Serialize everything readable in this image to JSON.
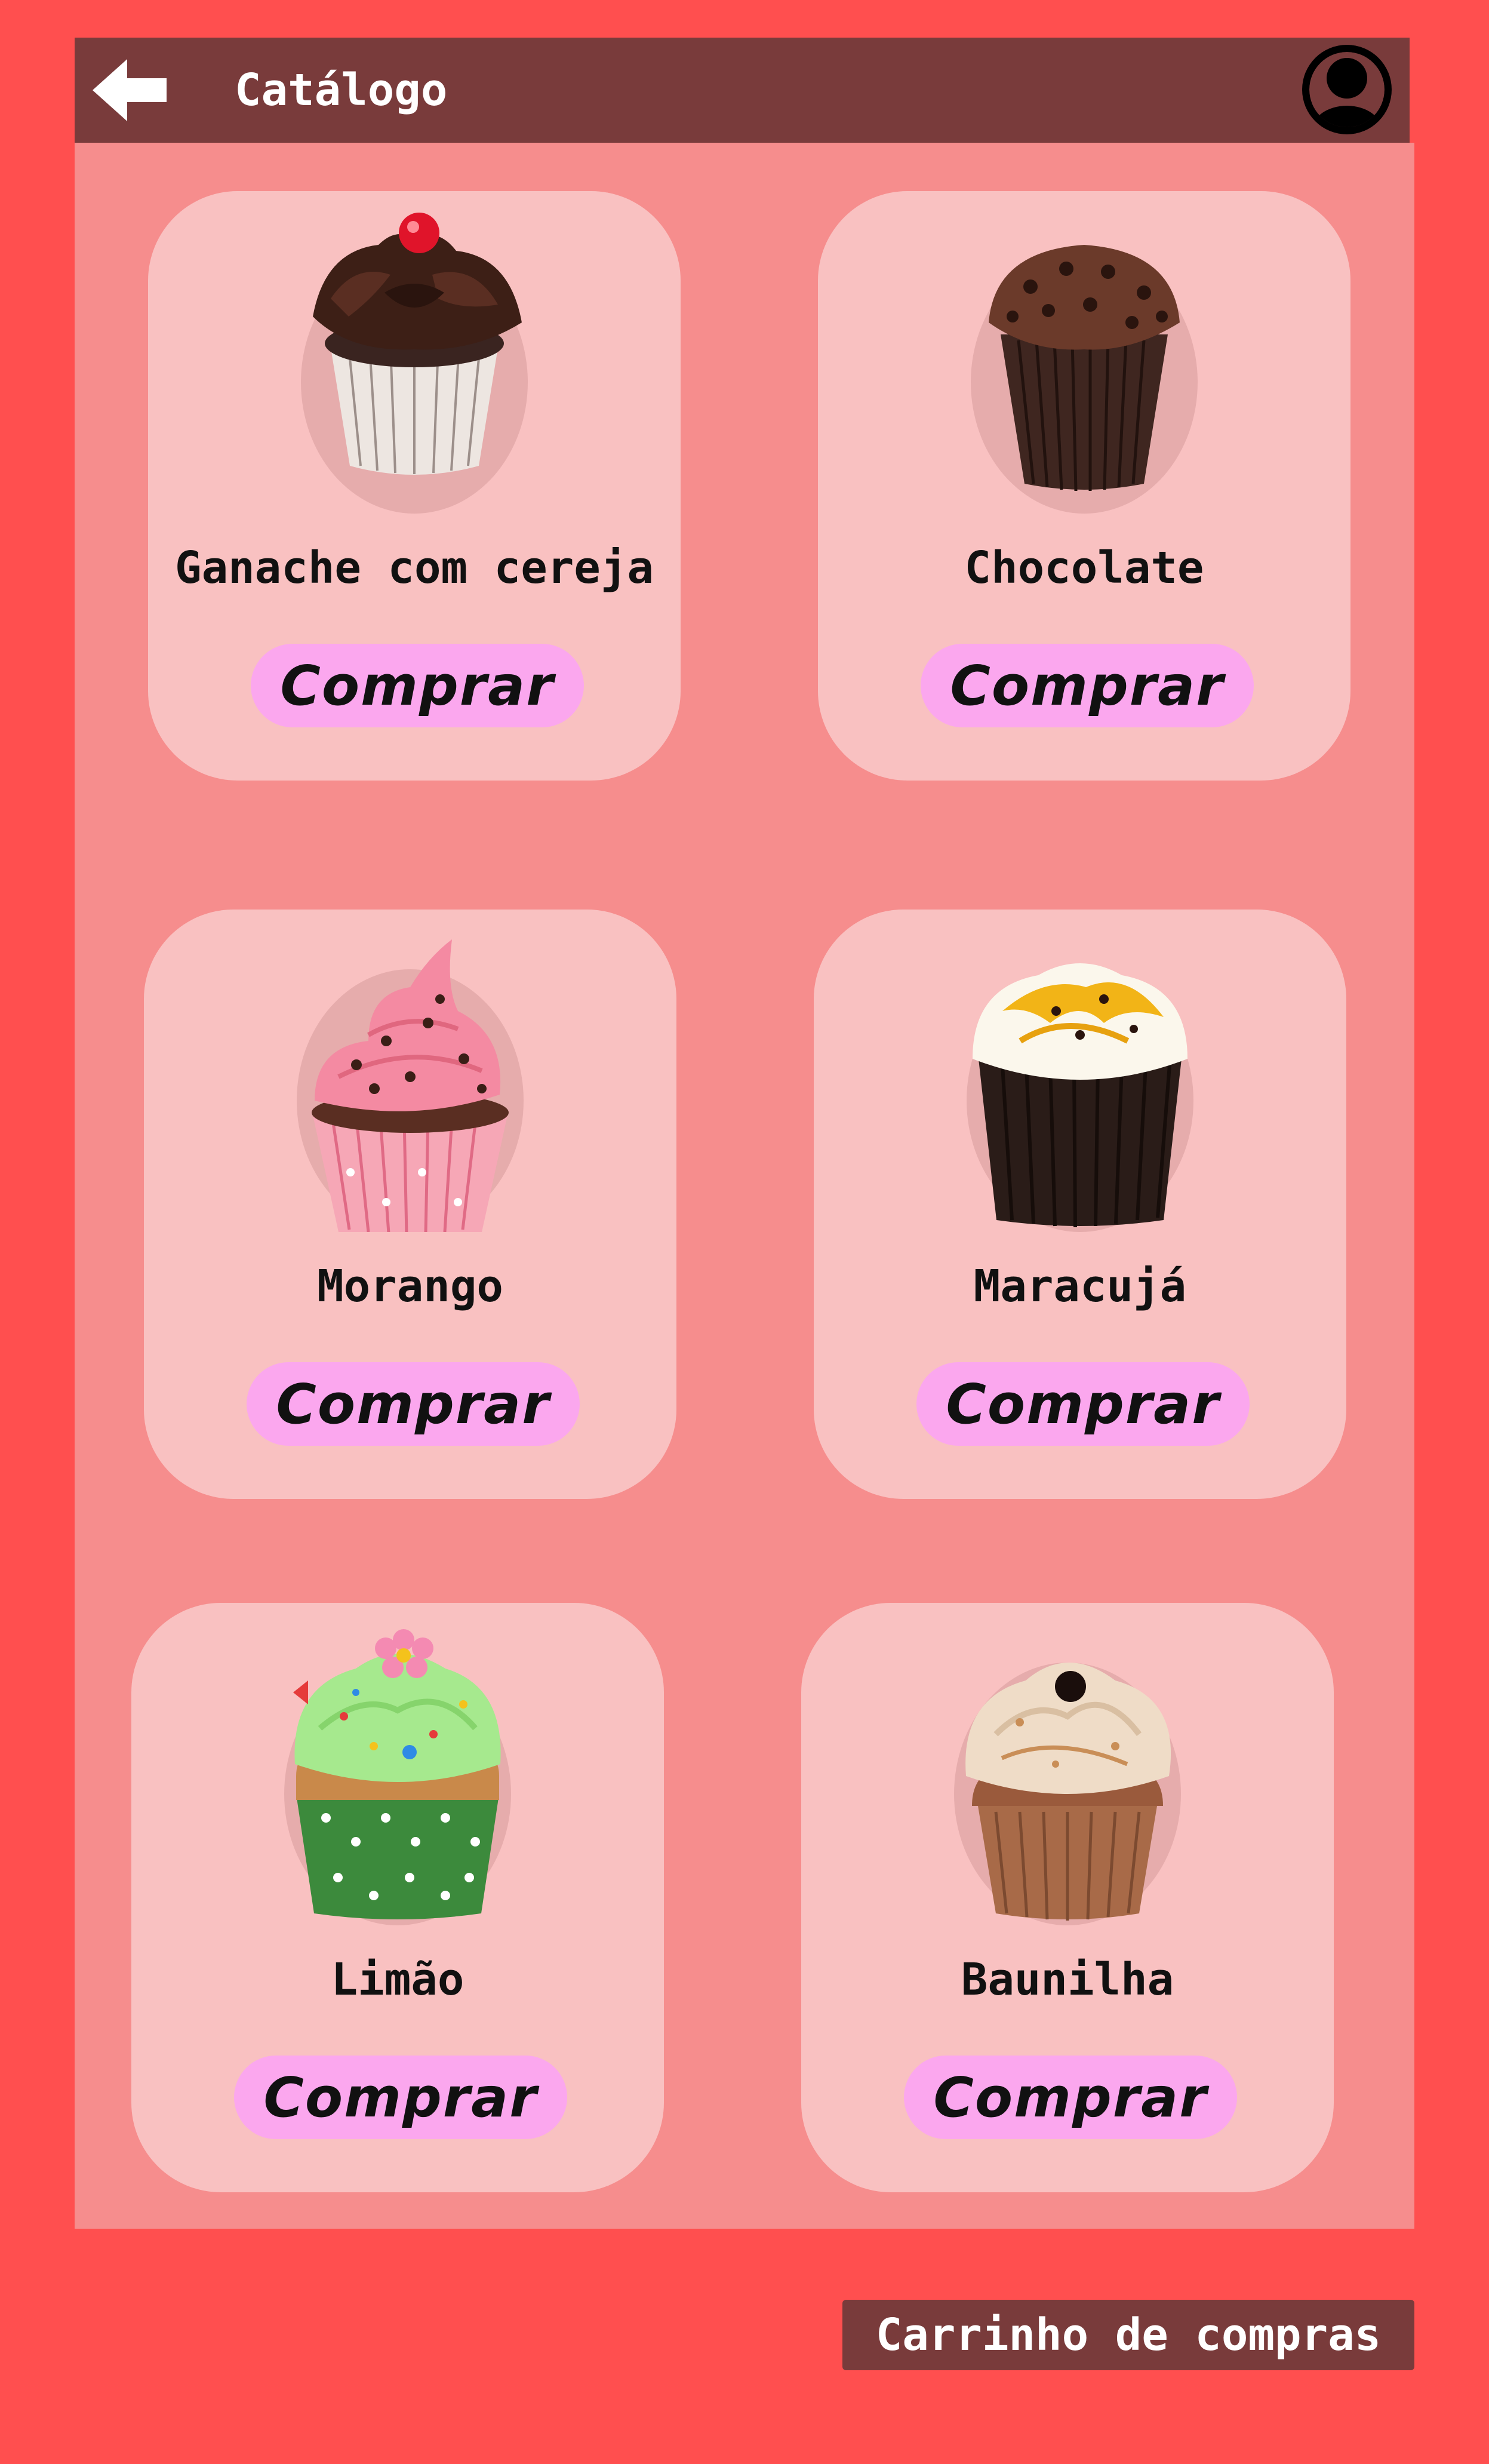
{
  "header": {
    "title": "Catálogo",
    "back_icon": "arrow-left-icon",
    "avatar_icon": "user-avatar-icon"
  },
  "products": [
    {
      "name": "Ganache com cereja",
      "button": "Comprar",
      "image": "cupcake-ganache-cherry"
    },
    {
      "name": "Chocolate",
      "button": "Comprar",
      "image": "cupcake-chocolate"
    },
    {
      "name": "Morango",
      "button": "Comprar",
      "image": "cupcake-strawberry"
    },
    {
      "name": "Maracujá",
      "button": "Comprar",
      "image": "cupcake-passion-fruit"
    },
    {
      "name": "Limão",
      "button": "Comprar",
      "image": "cupcake-lemon"
    },
    {
      "name": "Baunilha",
      "button": "Comprar",
      "image": "cupcake-vanilla"
    }
  ],
  "cart_button": "Carrinho de compras",
  "colors": {
    "background": "#FF4F4F",
    "header": "#793B3B",
    "panel": "#F68D8D",
    "card": "#F9C1C1",
    "button": "#FBA7EE"
  }
}
